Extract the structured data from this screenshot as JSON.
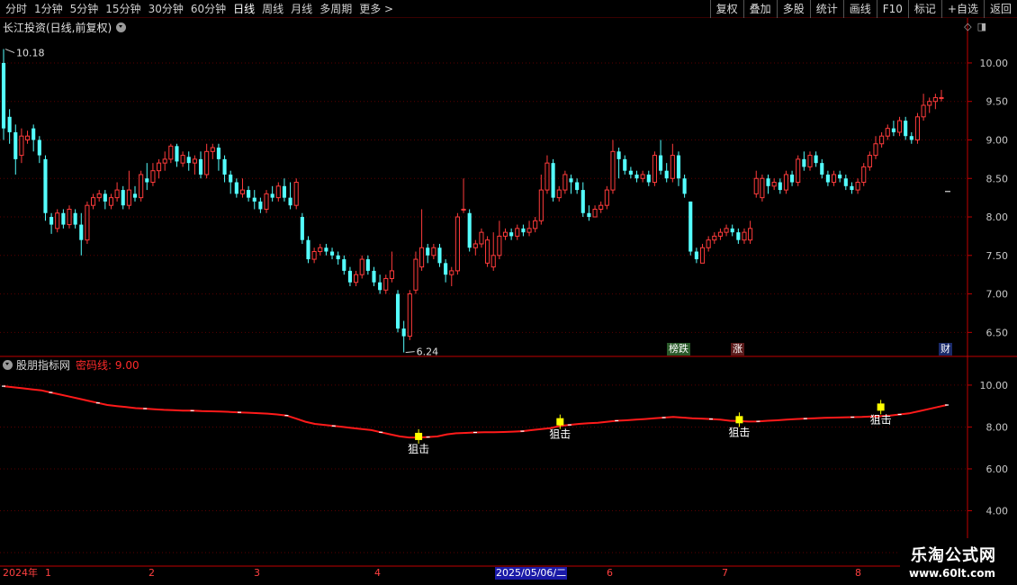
{
  "toolbar": {
    "periods": [
      "分时",
      "1分钟",
      "5分钟",
      "15分钟",
      "30分钟",
      "60分钟",
      "日线",
      "周线",
      "月线",
      "多周期",
      "更多 >"
    ],
    "active_period": "日线",
    "buttons": [
      "复权",
      "叠加",
      "多股",
      "统计",
      "画线",
      "F10",
      "标记",
      "+自选",
      "返回"
    ]
  },
  "main_title": "长江投资(日线,前复权)",
  "indicator": {
    "name": "股朋指标网",
    "line_label": "密码线: 9.00"
  },
  "markers": {
    "high": "10.18",
    "low": "6.24",
    "tag_bang": "榜跌",
    "tag_zhang": "涨",
    "tag_cai": "财",
    "signal_text": "狙击"
  },
  "dates": {
    "year": "2024年",
    "months": [
      "1",
      "2",
      "3",
      "4",
      "6",
      "7",
      "8"
    ],
    "highlight": "2025/05/06/二"
  },
  "watermark": {
    "title": "乐淘公式网",
    "url": "www.60lt.com"
  },
  "colors": {
    "up": "#ff3b3b",
    "down": "#54ffff",
    "axis": "#c00000",
    "line": "#ff1a1a",
    "signal": "#ffff00"
  },
  "chart_data": [
    {
      "type": "candlestick",
      "title": "长江投资(日线,前复权)",
      "ylim": [
        6.2,
        10.35
      ],
      "yticks": [
        6.5,
        7.0,
        7.5,
        8.0,
        8.5,
        9.0,
        9.5,
        10.0
      ],
      "high_label": 10.18,
      "low_label": 6.24,
      "candles": [
        [
          10.0,
          9.15,
          10.18,
          9.0
        ],
        [
          9.3,
          9.1,
          9.4,
          8.95
        ],
        [
          9.1,
          8.75,
          9.2,
          8.55
        ],
        [
          8.8,
          9.05,
          9.15,
          8.7
        ],
        [
          9.0,
          9.05,
          9.12,
          8.95
        ],
        [
          9.15,
          9.0,
          9.2,
          8.85
        ],
        [
          9.0,
          8.8,
          9.05,
          8.7
        ],
        [
          8.75,
          8.05,
          8.8,
          7.95
        ],
        [
          8.0,
          7.9,
          8.05,
          7.78
        ],
        [
          7.85,
          8.05,
          8.1,
          7.8
        ],
        [
          8.05,
          7.9,
          8.1,
          7.85
        ],
        [
          7.9,
          8.1,
          8.15,
          7.85
        ],
        [
          8.05,
          7.9,
          8.1,
          7.85
        ],
        [
          7.9,
          7.7,
          8.05,
          7.5
        ],
        [
          7.7,
          8.15,
          8.2,
          7.65
        ],
        [
          8.15,
          8.25,
          8.3,
          8.1
        ],
        [
          8.25,
          8.3,
          8.35,
          8.2
        ],
        [
          8.3,
          8.2,
          8.35,
          8.1
        ],
        [
          8.15,
          8.25,
          8.3,
          8.1
        ],
        [
          8.25,
          8.35,
          8.45,
          8.2
        ],
        [
          8.35,
          8.15,
          8.4,
          8.1
        ],
        [
          8.15,
          8.35,
          8.6,
          8.1
        ],
        [
          8.3,
          8.25,
          8.4,
          8.2
        ],
        [
          8.25,
          8.55,
          8.6,
          8.2
        ],
        [
          8.5,
          8.45,
          8.7,
          8.35
        ],
        [
          8.45,
          8.6,
          8.7,
          8.4
        ],
        [
          8.6,
          8.7,
          8.75,
          8.5
        ],
        [
          8.7,
          8.75,
          8.85,
          8.6
        ],
        [
          8.75,
          8.92,
          8.95,
          8.7
        ],
        [
          8.92,
          8.72,
          8.95,
          8.65
        ],
        [
          8.7,
          8.8,
          8.85,
          8.65
        ],
        [
          8.78,
          8.7,
          8.85,
          8.6
        ],
        [
          8.7,
          8.75,
          8.8,
          8.55
        ],
        [
          8.75,
          8.55,
          8.85,
          8.5
        ],
        [
          8.55,
          8.85,
          8.95,
          8.5
        ],
        [
          8.85,
          8.9,
          8.95,
          8.75
        ],
        [
          8.9,
          8.75,
          8.95,
          8.6
        ],
        [
          8.75,
          8.55,
          8.8,
          8.45
        ],
        [
          8.55,
          8.45,
          8.6,
          8.3
        ],
        [
          8.45,
          8.3,
          8.5,
          8.25
        ],
        [
          8.3,
          8.35,
          8.5,
          8.25
        ],
        [
          8.35,
          8.25,
          8.4,
          8.2
        ],
        [
          8.25,
          8.2,
          8.35,
          8.1
        ],
        [
          8.2,
          8.1,
          8.25,
          8.05
        ],
        [
          8.1,
          8.3,
          8.35,
          8.05
        ],
        [
          8.3,
          8.25,
          8.4,
          8.2
        ],
        [
          8.25,
          8.4,
          8.45,
          8.2
        ],
        [
          8.4,
          8.25,
          8.5,
          8.2
        ],
        [
          8.25,
          8.15,
          8.45,
          8.1
        ],
        [
          8.15,
          8.45,
          8.5,
          8.1
        ],
        [
          8.0,
          7.7,
          8.05,
          7.65
        ],
        [
          7.7,
          7.45,
          7.75,
          7.4
        ],
        [
          7.45,
          7.55,
          7.6,
          7.4
        ],
        [
          7.55,
          7.6,
          7.65,
          7.5
        ],
        [
          7.6,
          7.55,
          7.65,
          7.5
        ],
        [
          7.55,
          7.5,
          7.6,
          7.45
        ],
        [
          7.5,
          7.45,
          7.55,
          7.38
        ],
        [
          7.45,
          7.3,
          7.5,
          7.25
        ],
        [
          7.3,
          7.15,
          7.35,
          7.1
        ],
        [
          7.15,
          7.25,
          7.3,
          7.1
        ],
        [
          7.25,
          7.45,
          7.5,
          7.2
        ],
        [
          7.45,
          7.3,
          7.5,
          7.25
        ],
        [
          7.3,
          7.15,
          7.35,
          7.1
        ],
        [
          7.15,
          7.05,
          7.25,
          7.0
        ],
        [
          7.05,
          7.2,
          7.25,
          7.0
        ],
        [
          7.2,
          7.3,
          7.55,
          7.15
        ],
        [
          7.0,
          6.55,
          7.05,
          6.5
        ],
        [
          6.55,
          6.45,
          6.65,
          6.24
        ],
        [
          6.45,
          7.0,
          7.05,
          6.4
        ],
        [
          7.05,
          7.45,
          7.55,
          7.0
        ],
        [
          7.35,
          7.6,
          8.1,
          7.3
        ],
        [
          7.6,
          7.5,
          7.65,
          7.4
        ],
        [
          7.5,
          7.6,
          7.65,
          7.45
        ],
        [
          7.6,
          7.4,
          7.65,
          7.35
        ],
        [
          7.4,
          7.25,
          7.45,
          7.15
        ],
        [
          7.25,
          7.3,
          7.35,
          7.1
        ],
        [
          7.3,
          8.0,
          8.05,
          7.25
        ],
        [
          8.1,
          8.1,
          8.5,
          8.05
        ],
        [
          8.05,
          7.6,
          8.1,
          7.55
        ],
        [
          7.6,
          7.65,
          7.7,
          7.5
        ],
        [
          7.65,
          7.8,
          7.85,
          7.6
        ],
        [
          7.4,
          7.7,
          7.75,
          7.35
        ],
        [
          7.35,
          7.5,
          7.8,
          7.3
        ],
        [
          7.5,
          7.75,
          7.95,
          7.45
        ],
        [
          7.75,
          7.8,
          7.85,
          7.7
        ],
        [
          7.8,
          7.75,
          7.85,
          7.7
        ],
        [
          7.75,
          7.85,
          7.9,
          7.7
        ],
        [
          7.85,
          7.8,
          7.9,
          7.75
        ],
        [
          7.8,
          7.85,
          7.95,
          7.75
        ],
        [
          7.85,
          7.95,
          8.0,
          7.8
        ],
        [
          7.95,
          8.35,
          8.55,
          7.9
        ],
        [
          8.35,
          8.7,
          8.8,
          8.3
        ],
        [
          8.7,
          8.25,
          8.75,
          8.2
        ],
        [
          8.25,
          8.35,
          8.4,
          8.2
        ],
        [
          8.35,
          8.55,
          8.6,
          8.3
        ],
        [
          8.5,
          8.45,
          8.55,
          8.3
        ],
        [
          8.45,
          8.35,
          8.5,
          8.3
        ],
        [
          8.35,
          8.05,
          8.45,
          8.0
        ],
        [
          8.05,
          8.0,
          8.15,
          7.95
        ],
        [
          8.0,
          8.1,
          8.15,
          8.0
        ],
        [
          8.1,
          8.15,
          8.2,
          8.05
        ],
        [
          8.15,
          8.35,
          8.4,
          8.1
        ],
        [
          8.35,
          8.85,
          9.0,
          8.3
        ],
        [
          8.85,
          8.75,
          8.9,
          8.5
        ],
        [
          8.75,
          8.6,
          8.8,
          8.55
        ],
        [
          8.6,
          8.55,
          8.65,
          8.5
        ],
        [
          8.55,
          8.5,
          8.6,
          8.45
        ],
        [
          8.5,
          8.55,
          8.6,
          8.45
        ],
        [
          8.55,
          8.45,
          8.6,
          8.4
        ],
        [
          8.45,
          8.8,
          8.85,
          8.4
        ],
        [
          8.8,
          8.6,
          9.0,
          8.55
        ],
        [
          8.6,
          8.5,
          8.7,
          8.45
        ],
        [
          8.5,
          8.8,
          8.95,
          8.45
        ],
        [
          8.8,
          8.5,
          8.85,
          8.4
        ],
        [
          8.5,
          8.3,
          8.55,
          8.25
        ],
        [
          8.2,
          7.55,
          8.2,
          7.5
        ],
        [
          7.55,
          7.45,
          7.6,
          7.4
        ],
        [
          7.4,
          7.6,
          7.65,
          7.4
        ],
        [
          7.6,
          7.7,
          7.75,
          7.55
        ],
        [
          7.7,
          7.75,
          7.8,
          7.65
        ],
        [
          7.75,
          7.8,
          7.85,
          7.7
        ],
        [
          7.8,
          7.85,
          7.9,
          7.75
        ],
        [
          7.85,
          7.8,
          7.9,
          7.75
        ],
        [
          7.8,
          7.7,
          7.85,
          7.65
        ],
        [
          7.7,
          7.8,
          7.85,
          7.65
        ],
        [
          7.7,
          7.85,
          7.95,
          7.65
        ],
        [
          8.3,
          8.5,
          8.6,
          8.25
        ],
        [
          8.25,
          8.5,
          8.55,
          8.2
        ],
        [
          8.5,
          8.4,
          8.55,
          8.3
        ],
        [
          8.4,
          8.45,
          8.5,
          8.35
        ],
        [
          8.45,
          8.35,
          8.5,
          8.3
        ],
        [
          8.35,
          8.55,
          8.6,
          8.3
        ],
        [
          8.55,
          8.45,
          8.6,
          8.4
        ],
        [
          8.45,
          8.75,
          8.8,
          8.4
        ],
        [
          8.75,
          8.65,
          8.85,
          8.6
        ],
        [
          8.65,
          8.8,
          8.85,
          8.6
        ],
        [
          8.8,
          8.7,
          8.85,
          8.65
        ],
        [
          8.7,
          8.55,
          8.75,
          8.5
        ],
        [
          8.55,
          8.45,
          8.6,
          8.4
        ],
        [
          8.45,
          8.55,
          8.6,
          8.4
        ],
        [
          8.55,
          8.5,
          8.6,
          8.45
        ],
        [
          8.5,
          8.4,
          8.55,
          8.35
        ],
        [
          8.4,
          8.35,
          8.45,
          8.3
        ],
        [
          8.35,
          8.45,
          8.5,
          8.3
        ],
        [
          8.45,
          8.65,
          8.7,
          8.4
        ],
        [
          8.65,
          8.8,
          8.85,
          8.6
        ],
        [
          8.8,
          8.95,
          9.05,
          8.75
        ],
        [
          8.95,
          9.05,
          9.1,
          8.9
        ],
        [
          9.05,
          9.15,
          9.2,
          9.0
        ],
        [
          9.15,
          9.1,
          9.25,
          9.05
        ],
        [
          9.1,
          9.25,
          9.3,
          9.05
        ],
        [
          9.25,
          9.05,
          9.3,
          9.0
        ],
        [
          9.05,
          9.0,
          9.1,
          8.95
        ],
        [
          9.0,
          9.3,
          9.35,
          8.95
        ],
        [
          9.3,
          9.45,
          9.6,
          9.25
        ],
        [
          9.45,
          9.5,
          9.55,
          9.35
        ],
        [
          9.5,
          9.55,
          9.6,
          9.4
        ],
        [
          9.55,
          9.55,
          9.65,
          9.5
        ]
      ]
    },
    {
      "type": "line",
      "title": "股朋指标网",
      "ylim": [
        1.4,
        11.2
      ],
      "yticks": [
        2.0,
        4.0,
        6.0,
        8.0,
        10.0
      ],
      "series": [
        {
          "name": "密码线",
          "values": [
            9.95,
            9.9,
            9.85,
            9.8,
            9.75,
            9.65,
            9.55,
            9.45,
            9.35,
            9.25,
            9.15,
            9.05,
            9.0,
            8.95,
            8.9,
            8.88,
            8.85,
            8.82,
            8.8,
            8.78,
            8.78,
            8.76,
            8.75,
            8.74,
            8.72,
            8.7,
            8.68,
            8.66,
            8.64,
            8.6,
            8.55,
            8.4,
            8.25,
            8.15,
            8.1,
            8.05,
            8.0,
            7.95,
            7.9,
            7.85,
            7.75,
            7.65,
            7.55,
            7.5,
            7.5,
            7.52,
            7.55,
            7.65,
            7.7,
            7.72,
            7.74,
            7.75,
            7.75,
            7.76,
            7.78,
            7.8,
            7.85,
            7.9,
            7.95,
            8.05,
            8.1,
            8.15,
            8.18,
            8.2,
            8.25,
            8.3,
            8.32,
            8.35,
            8.38,
            8.42,
            8.45,
            8.48,
            8.45,
            8.42,
            8.4,
            8.38,
            8.35,
            8.3,
            8.28,
            8.26,
            8.27,
            8.3,
            8.32,
            8.35,
            8.38,
            8.4,
            8.42,
            8.44,
            8.45,
            8.46,
            8.47,
            8.48,
            8.5,
            8.52,
            8.55,
            8.6,
            8.65,
            8.75,
            8.85,
            8.95,
            9.05
          ]
        }
      ],
      "signals": [
        {
          "label": "狙击",
          "index": 44,
          "value": 7.55
        },
        {
          "label": "狙击",
          "index": 59,
          "value": 8.25
        },
        {
          "label": "狙击",
          "index": 78,
          "value": 8.35
        },
        {
          "label": "狙击",
          "index": 93,
          "value": 8.95
        }
      ]
    }
  ]
}
